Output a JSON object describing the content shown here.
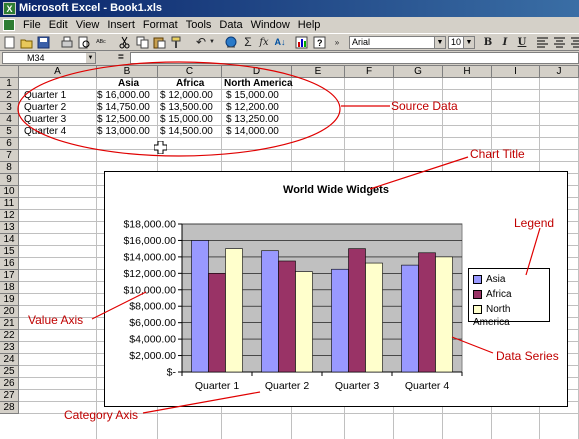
{
  "window": {
    "title": "Microsoft Excel - Book1.xls"
  },
  "menu": [
    "File",
    "Edit",
    "View",
    "Insert",
    "Format",
    "Tools",
    "Data",
    "Window",
    "Help"
  ],
  "toolbar": {
    "font_name": "Arial",
    "font_size": "10",
    "bold": "B",
    "italic": "I",
    "underline": "U",
    "sum": "Σ",
    "fx": "fx",
    "sort": "A↓"
  },
  "formula_bar": {
    "name_box": "M34",
    "equals": "=",
    "content": ""
  },
  "columns": [
    "A",
    "B",
    "C",
    "D",
    "E",
    "F",
    "G",
    "H",
    "I",
    "J"
  ],
  "rows": [
    "1",
    "2",
    "3",
    "4",
    "5",
    "6",
    "7",
    "8",
    "9",
    "10",
    "11",
    "12",
    "13",
    "14",
    "15",
    "16",
    "17",
    "18",
    "19",
    "20",
    "21",
    "22",
    "23",
    "24",
    "25",
    "26",
    "27",
    "28"
  ],
  "sheet": {
    "headers": [
      "Asia",
      "Africa",
      "North America"
    ],
    "data": [
      {
        "label": "Quarter 1",
        "asia": "$    16,000.00",
        "africa": "$ 12,000.00",
        "na": "$      15,000.00"
      },
      {
        "label": "Quarter 2",
        "asia": "$    14,750.00",
        "africa": "$ 13,500.00",
        "na": "$      12,200.00"
      },
      {
        "label": "Quarter 3",
        "asia": "$    12,500.00",
        "africa": "$ 15,000.00",
        "na": "$      13,250.00"
      },
      {
        "label": "Quarter 4",
        "asia": "$    13,000.00",
        "africa": "$ 14,500.00",
        "na": "$      14,000.00"
      }
    ]
  },
  "annotations": {
    "source_data": "Source Data",
    "chart_title": "Chart Title",
    "legend": "Legend",
    "value_axis": "Value Axis",
    "data_series": "Data Series",
    "category_axis": "Category Axis"
  },
  "colors": {
    "asia": "#9999ff",
    "africa": "#993366",
    "north_america": "#ffffcc",
    "plot_area": "#c0c0c0",
    "annotation": "#c00000"
  },
  "chart_data": {
    "type": "bar",
    "title": "World Wide Widgets",
    "categories": [
      "Quarter 1",
      "Quarter 2",
      "Quarter 3",
      "Quarter 4"
    ],
    "series": [
      {
        "name": "Asia",
        "values": [
          16000,
          14750,
          12500,
          13000
        ]
      },
      {
        "name": "Africa",
        "values": [
          12000,
          13500,
          15000,
          14500
        ]
      },
      {
        "name": "North America",
        "values": [
          15000,
          12200,
          13250,
          14000
        ]
      }
    ],
    "ylim": [
      0,
      18000
    ],
    "yticks": [
      0,
      2000,
      4000,
      6000,
      8000,
      10000,
      12000,
      14000,
      16000,
      18000
    ],
    "ytick_labels": [
      "$-",
      "$2,000.00",
      "$4,000.00",
      "$6,000.00",
      "$8,000.00",
      "$10,000.00",
      "$12,000.00",
      "$14,000.00",
      "$16,000.00",
      "$18,000.00"
    ],
    "grid": true,
    "legend_position": "right"
  }
}
